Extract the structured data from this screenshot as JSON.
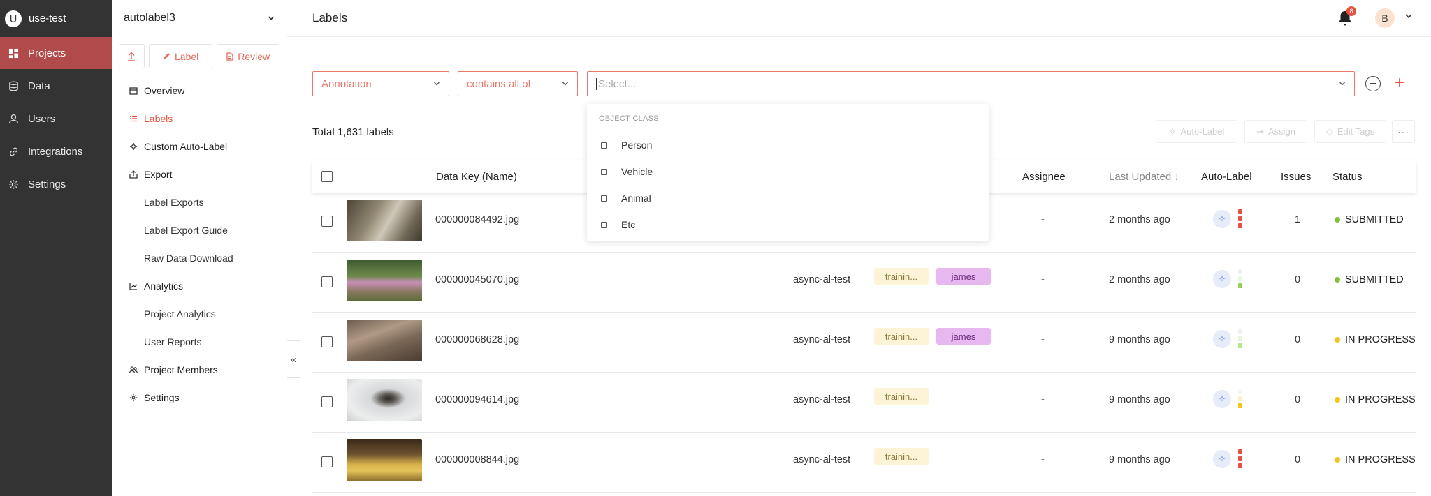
{
  "workspace": {
    "initial": "U",
    "name": "use-test"
  },
  "nav": [
    {
      "label": "Projects",
      "icon": "grid-icon"
    },
    {
      "label": "Data",
      "icon": "database-icon"
    },
    {
      "label": "Users",
      "icon": "user-icon"
    },
    {
      "label": "Integrations",
      "icon": "link-icon"
    },
    {
      "label": "Settings",
      "icon": "gear-icon"
    }
  ],
  "project": {
    "name": "autolabel3",
    "tools": {
      "label": "Label",
      "review": "Review"
    },
    "menu": [
      "Overview",
      "Labels",
      "Custom Auto-Label",
      "Export",
      "Label Exports",
      "Label Export Guide",
      "Raw Data Download",
      "Analytics",
      "Project Analytics",
      "User Reports",
      "Project Members",
      "Settings"
    ],
    "collapse": "«"
  },
  "header": {
    "title": "Labels",
    "notifications": "8",
    "user_initial": "B"
  },
  "filter": {
    "field": "Annotation",
    "operator": "contains all of",
    "value_placeholder": "Select..."
  },
  "dropdown": {
    "group": "OBJECT CLASS",
    "options": [
      "Person",
      "Vehicle",
      "Animal",
      "Etc"
    ]
  },
  "summary": {
    "total": "Total 1,631 labels"
  },
  "actions": {
    "auto_label": "Auto-Label",
    "assign": "Assign",
    "edit_tags": "Edit Tags",
    "more": "···"
  },
  "table": {
    "headers": {
      "key": "Data Key (Name)",
      "assignee": "Assignee",
      "updated": "Last Updated ↓",
      "autolabel": "Auto-Label",
      "issues": "Issues",
      "status": "Status"
    },
    "rows": [
      {
        "key": "000000084492.jpg",
        "project": "",
        "tag": "",
        "labeler": "",
        "assignee": "-",
        "updated": "2 months ago",
        "issues": "1",
        "status": "SUBMITTED",
        "status_color": "#7cc33a",
        "bars": [
          "#e8503f",
          "#e8503f",
          "#e8503f"
        ]
      },
      {
        "key": "000000045070.jpg",
        "project": "async-al-test",
        "tag": "trainin...",
        "labeler": "james",
        "assignee": "-",
        "updated": "2 months ago",
        "issues": "0",
        "status": "SUBMITTED",
        "status_color": "#7cc33a",
        "bars": [
          "#f0f0f0",
          "#e8f6dc",
          "#8fd45a"
        ]
      },
      {
        "key": "000000068628.jpg",
        "project": "async-al-test",
        "tag": "trainin...",
        "labeler": "james",
        "assignee": "-",
        "updated": "9 months ago",
        "issues": "0",
        "status": "IN PROGRESS",
        "status_color": "#f2c413",
        "bars": [
          "#f0f0f0",
          "#e8f6dc",
          "#b8e68a"
        ]
      },
      {
        "key": "000000094614.jpg",
        "project": "async-al-test",
        "tag": "trainin...",
        "labeler": "",
        "assignee": "-",
        "updated": "9 months ago",
        "issues": "0",
        "status": "IN PROGRESS",
        "status_color": "#f2c413",
        "bars": [
          "#f5f5f5",
          "#fdf0c4",
          "#f2c413"
        ]
      },
      {
        "key": "000000008844.jpg",
        "project": "async-al-test",
        "tag": "trainin...",
        "labeler": "",
        "assignee": "-",
        "updated": "9 months ago",
        "issues": "0",
        "status": "IN PROGRESS",
        "status_color": "#f2c413",
        "bars": [
          "#e8503f",
          "#e8503f",
          "#e8503f"
        ]
      }
    ]
  }
}
